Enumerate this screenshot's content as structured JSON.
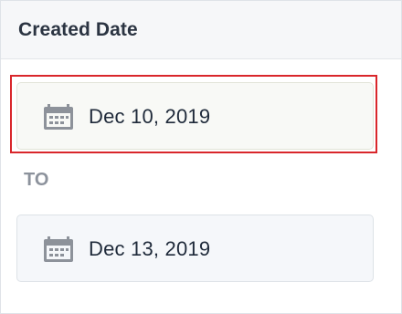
{
  "filter": {
    "title": "Created Date",
    "from": {
      "value": "Dec 10, 2019",
      "icon": "calendar-icon"
    },
    "separator": "TO",
    "to": {
      "value": "Dec 13, 2019",
      "icon": "calendar-icon"
    }
  },
  "colors": {
    "focus_outline": "#d9262b",
    "icon": "#8d929a",
    "text": "#1f2a3a",
    "muted": "#8c929c"
  }
}
